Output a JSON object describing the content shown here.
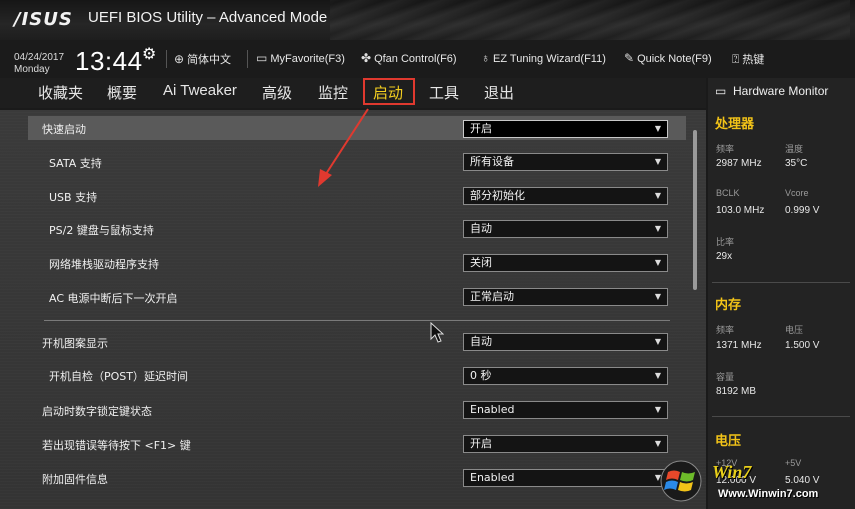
{
  "header": {
    "logo": "/ISUS",
    "title": "UEFI BIOS Utility – Advanced Mode",
    "date": "04/24/2017",
    "weekday": "Monday",
    "time": "13:44",
    "toolbar": [
      {
        "icon": "globe-icon",
        "label": "简体中文"
      },
      {
        "icon": "favorite-icon",
        "label": "MyFavorite(F3)"
      },
      {
        "icon": "fan-icon",
        "label": "Qfan Control(F6)"
      },
      {
        "icon": "lightbulb-icon",
        "label": "EZ Tuning Wizard(F11)"
      },
      {
        "icon": "note-icon",
        "label": "Quick Note(F9)"
      },
      {
        "icon": "help-icon",
        "label": "热键"
      }
    ]
  },
  "tabs": [
    {
      "label": "收藏夹",
      "active": false
    },
    {
      "label": "概要",
      "active": false
    },
    {
      "label": "Ai Tweaker",
      "active": false
    },
    {
      "label": "高级",
      "active": false
    },
    {
      "label": "监控",
      "active": false
    },
    {
      "label": "启动",
      "active": true
    },
    {
      "label": "工具",
      "active": false
    },
    {
      "label": "退出",
      "active": false
    }
  ],
  "settings": [
    {
      "label": "快速启动",
      "value": "开启",
      "selected": true
    },
    {
      "label": "SATA 支持",
      "value": "所有设备"
    },
    {
      "label": "USB 支持",
      "value": "部分初始化"
    },
    {
      "label": "PS/2 键盘与鼠标支持",
      "value": "自动"
    },
    {
      "label": "网络堆栈驱动程序支持",
      "value": "关闭"
    },
    {
      "label": "AC 电源中断后下一次开启",
      "value": "正常启动"
    },
    {
      "label": "开机图案显示",
      "value": "自动"
    },
    {
      "label": "开机自检（POST）延迟时间",
      "value": "0 秒"
    },
    {
      "label": "启动时数字锁定键状态",
      "value": "Enabled"
    },
    {
      "label": "若出现错误等待按下 <F1> 键",
      "value": "开启"
    },
    {
      "label": "附加固件信息",
      "value": "Enabled"
    }
  ],
  "hardware_monitor": {
    "title": "Hardware Monitor",
    "cpu": {
      "heading": "处理器",
      "freq_label": "频率",
      "freq": "2987 MHz",
      "temp_label": "温度",
      "temp": "35°C",
      "bclk_label": "BCLK",
      "bclk": "103.0 MHz",
      "vcore_label": "Vcore",
      "vcore": "0.999 V",
      "ratio_label": "比率",
      "ratio": "29x"
    },
    "memory": {
      "heading": "内存",
      "freq_label": "频率",
      "freq": "1371 MHz",
      "volt_label": "电压",
      "volt": "1.500 V",
      "cap_label": "容量",
      "cap": "8192 MB"
    },
    "voltage": {
      "heading": "电压",
      "v12_label": "+12V",
      "v12": "12.000 V",
      "v5_label": "+5V",
      "v5": "5.040 V"
    }
  },
  "watermark": {
    "brand": "Win7",
    "url": "Www.Winwin7.com"
  },
  "colors": {
    "accent": "#f5d020",
    "highlight_box": "#e0392f",
    "section_heading": "#f2c318"
  }
}
